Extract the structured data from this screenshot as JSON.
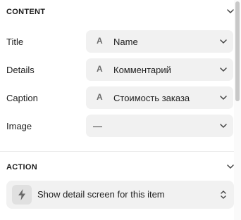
{
  "content_section": {
    "title": "CONTENT",
    "rows": [
      {
        "label": "Title",
        "value": "Name",
        "icon": "text-type-icon",
        "type_glyph": "A"
      },
      {
        "label": "Details",
        "value": "Комментарий",
        "icon": "text-type-icon",
        "type_glyph": "A"
      },
      {
        "label": "Caption",
        "value": "Стоимость заказа",
        "icon": "text-type-icon",
        "type_glyph": "A"
      },
      {
        "label": "Image",
        "value": "—",
        "icon": "none"
      }
    ]
  },
  "action_section": {
    "title": "ACTION",
    "action": {
      "label": "Show detail screen for this item",
      "icon": "lightning-bolt-icon"
    }
  },
  "colors": {
    "field_bg": "#f1f1f1",
    "icon_box_bg": "#e0e0e0",
    "scroll_thumb": "#c8c8c8"
  }
}
